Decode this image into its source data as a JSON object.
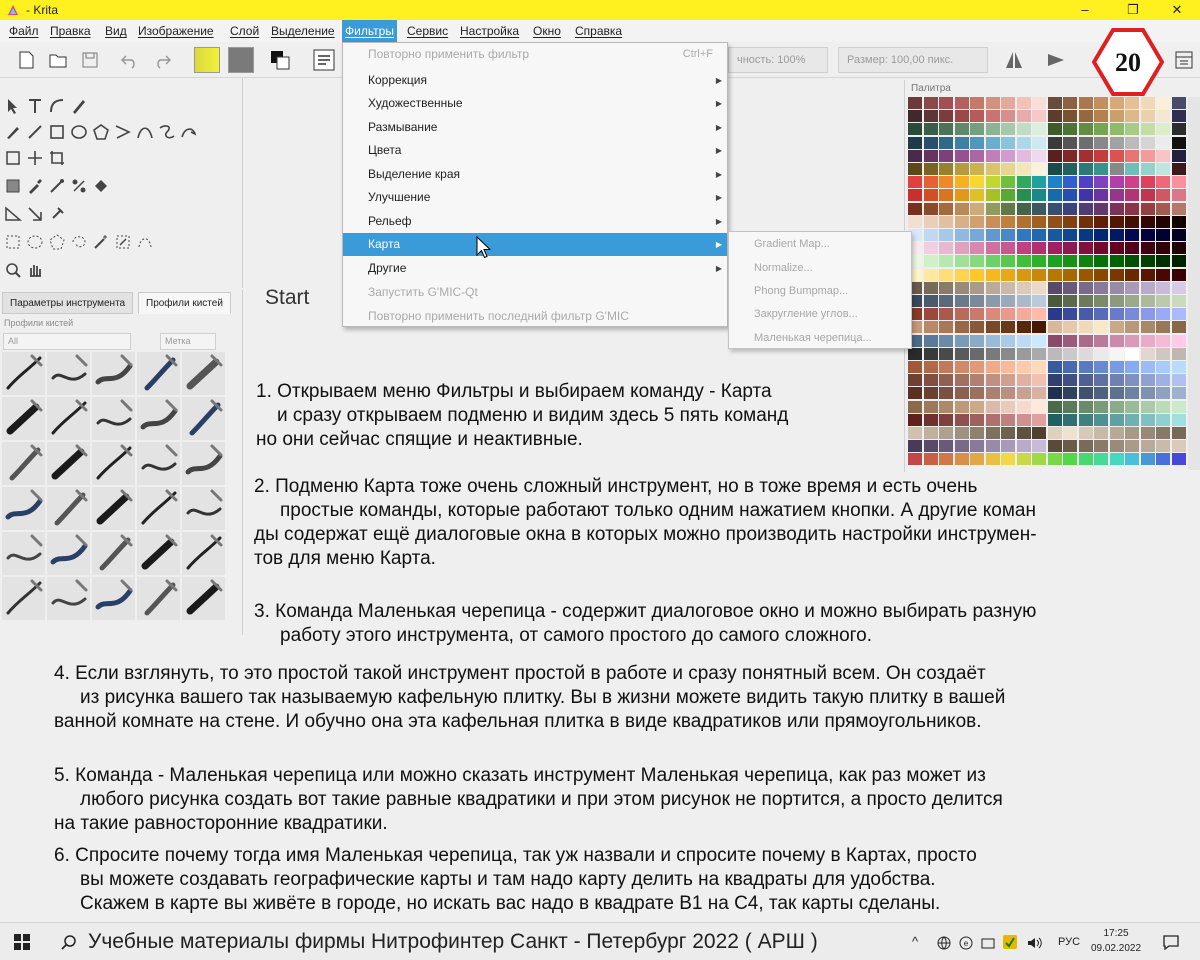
{
  "window": {
    "title": " - Krita",
    "minimize": "–",
    "maximize": "❐",
    "close": "✕"
  },
  "menu": [
    {
      "label": "Файл"
    },
    {
      "label": "Правка"
    },
    {
      "label": "Вид"
    },
    {
      "label": "Изображение"
    },
    {
      "label": "Слой"
    },
    {
      "label": "Выделение"
    },
    {
      "label": "Фильтры"
    },
    {
      "label": "Сервис"
    },
    {
      "label": "Настройка"
    },
    {
      "label": "Окно"
    },
    {
      "label": "Справка"
    }
  ],
  "toolbar": {
    "opacity_field": "чность: 100%",
    "size_field": "Размер: 100,00 пикс."
  },
  "filters_menu": {
    "items": [
      {
        "label": "Повторно применить фильтр",
        "shortcut": "Ctrl+F",
        "state": "disabled"
      },
      {
        "label": "Коррекция",
        "arrow": "▶"
      },
      {
        "label": "Художественные",
        "arrow": "▶"
      },
      {
        "label": "Размывание",
        "arrow": "▶"
      },
      {
        "label": "Цвета",
        "arrow": "▶"
      },
      {
        "label": "Выделение края",
        "arrow": "▶"
      },
      {
        "label": "Улучшение",
        "arrow": "▶"
      },
      {
        "label": "Рельеф",
        "arrow": "▶"
      },
      {
        "label": "Карта",
        "arrow": "▶",
        "state": "highlighted"
      },
      {
        "label": "Другие",
        "arrow": "▶"
      },
      {
        "label": "Запустить G'MIC-Qt",
        "state": "disabled"
      },
      {
        "label": "Повторно применить последний фильтр G'MIC",
        "state": "disabled"
      }
    ]
  },
  "map_submenu": {
    "items": [
      {
        "label": "Gradient Map..."
      },
      {
        "label": "Normalize..."
      },
      {
        "label": "Phong Bumpmap..."
      },
      {
        "label": "Закругление углов..."
      },
      {
        "label": "Маленькая черепица..."
      }
    ]
  },
  "left_dock": {
    "tab_tool_options": "Параметры инструмента",
    "tab_brush_presets": "Профили кистей",
    "title": "Профили кистей",
    "filter_value": "All",
    "tag_label": "Метка"
  },
  "canvas": {
    "start_label": "Start"
  },
  "palette": {
    "title": "Палитра"
  },
  "badge": {
    "number": "20"
  },
  "annotation": {
    "p1": [
      "1. Открываем меню Фильтры и выбираем команду - Карта",
      "и сразу открываем подменю и видим здесь 5 пять команд",
      "но они сейчас спящие и неактивные."
    ],
    "p2": [
      "2. Подменю Карта тоже очень сложный инструмент, но в тоже время и есть очень",
      "простые команды, которые работают только одним нажатием кнопки. А другие коман",
      "ды содержат ещё диалоговые окна в которых можно производить настройки инструмен-",
      "тов для меню Карта."
    ],
    "p3": [
      "3. Команда Маленькая черепица - содержит диалоговое окно и можно выбирать разную",
      "работу этого инструмента, от самого простого до самого сложного."
    ],
    "p4": [
      "4. Если взглянуть, то это простой такой инструмент простой в работе и сразу понятный всем. Он создаёт",
      "из рисунка вашего так называемую кафельную плитку. Вы в жизни можете видить такую плитку в вашей",
      "ванной комнате на стене. И обучно она эта кафельная плитка в виде квадратиков или прямоугольников."
    ],
    "p5": [
      "5. Команда - Маленькая черепица или можно сказать инструмент Маленькая черепица, как раз может из",
      "любого рисунка создать вот такие равные квадратики и при этом рисунок не портится, а просто делится",
      "на такие равносторонние квадратики."
    ],
    "p6": [
      "6. Спросите почему тогда имя Маленькая черепица, так уж назвали и спросите почему в Картах, просто",
      "вы можете создавать географические карты и там надо карту делить на квадраты для удобства.",
      "Скажем в карте вы живёте в городе, но искать вас надо в квадрате В1 на С4, так карты сделаны."
    ]
  },
  "taskbar": {
    "search_text": "Учебные материалы фирмы Нитрофинтер Санкт - Петербург  2022 ( АРШ )",
    "tray_chevron": "^",
    "lang": "РУС",
    "time": "17:25",
    "date": "09.02.2022"
  },
  "palette_colors": [
    "#6b3b3b",
    "#8a4a4a",
    "#a05050",
    "#b56060",
    "#c47a6a",
    "#d49080",
    "#e3a99a",
    "#f0c3b5",
    "#f8ded4",
    "#6a4a3a",
    "#8c6242",
    "#a9784f",
    "#c48f5f",
    "#d8a878",
    "#e6c094",
    "#f1d8b8",
    "#fbeedc",
    "#4a4a6a",
    "#3e2a2a",
    "#5e3535",
    "#7a3c3c",
    "#9a4848",
    "#b55b5b",
    "#c97373",
    "#d98e8e",
    "#e8abab",
    "#f3c9c9",
    "#5b3d2b",
    "#7a5233",
    "#95683e",
    "#b3824d",
    "#caa06a",
    "#dbb98a",
    "#e9d1ae",
    "#f5e7d2",
    "#2f2f52",
    "#2a4a3a",
    "#3a5e48",
    "#4b7358",
    "#5e8a6a",
    "#73a07e",
    "#8ab594",
    "#a4c9ab",
    "#c0dcc5",
    "#dcedde",
    "#3d5b2b",
    "#4f7335",
    "#628c40",
    "#77a550",
    "#8fba68",
    "#a8cc86",
    "#c2dda6",
    "#dcedc8",
    "#2d2d2d",
    "#1f3a4a",
    "#28506a",
    "#316888",
    "#3d80a3",
    "#5196bb",
    "#6badcc",
    "#8ac3da",
    "#abd7e6",
    "#cfe9f1",
    "#3a3a3a",
    "#555555",
    "#6e6e6e",
    "#888888",
    "#a2a2a2",
    "#bbbbbb",
    "#d4d4d4",
    "#ececec",
    "#111111",
    "#4a2a4a",
    "#63355f",
    "#7c4178",
    "#955190",
    "#ab66a6",
    "#c07fbb",
    "#d29bce",
    "#e2b9df",
    "#f0d8ee",
    "#5a2020",
    "#802828",
    "#a33030",
    "#c43c3c",
    "#dc5252",
    "#e87474",
    "#f19b9b",
    "#f8c4c4",
    "#202040",
    "#5a4a1a",
    "#7a6422",
    "#99802b",
    "#b69b38",
    "#cdb24c",
    "#dcc46a",
    "#e8d68e",
    "#f2e6b6",
    "#f9f2dc",
    "#1a4a4a",
    "#22615f",
    "#2b7a76",
    "#38938d",
    "#4dabа3",
    "#6cc0b8",
    "#93d3cc",
    "#bee5e0",
    "#3a1a1a",
    "#e04040",
    "#e86030",
    "#f08828",
    "#f8b020",
    "#f8d830",
    "#c0d830",
    "#70c040",
    "#30a860",
    "#20a0a0",
    "#2080c8",
    "#3060d0",
    "#5040c8",
    "#8040c0",
    "#b040a8",
    "#d04088",
    "#e04060",
    "#f06878",
    "#f890a0",
    "#c83030",
    "#d04f25",
    "#d87520",
    "#e09a18",
    "#e0c028",
    "#a8c028",
    "#5aa835",
    "#259050",
    "#188888",
    "#186aa8",
    "#2550b0",
    "#4035a8",
    "#6a35a0",
    "#95358c",
    "#b03570",
    "#c0354f",
    "#d05864",
    "#d87888",
    "#7a2f1f",
    "#8d4a2a",
    "#a36a3b",
    "#b88a55",
    "#cbab78",
    "#8f9c5c",
    "#627a4a",
    "#45634d",
    "#3a5a60",
    "#35506f",
    "#3b4478",
    "#4d3d72",
    "#63386b",
    "#7a3459",
    "#8a3446",
    "#944040",
    "#a35c52",
    "#b37a6b",
    "#f0e0d0",
    "#e8d0b8",
    "#e0c0a0",
    "#d8b088",
    "#d0a070",
    "#c89058",
    "#c08040",
    "#b07030",
    "#a06020",
    "#905018",
    "#804010",
    "#703008",
    "#602008",
    "#501800",
    "#401000",
    "#300800",
    "#200400",
    "#100000",
    "#d8e8f8",
    "#c0d8f0",
    "#a8c8e8",
    "#90b8e0",
    "#78a8d8",
    "#6098d0",
    "#4888c8",
    "#3078c0",
    "#2068b0",
    "#1858a0",
    "#104890",
    "#083880",
    "#042870",
    "#021860",
    "#010850",
    "#000040",
    "#000030",
    "#000020",
    "#f8e8f0",
    "#f0d0e0",
    "#e8b8d0",
    "#e0a0c0",
    "#d888b0",
    "#d070a0",
    "#c85890",
    "#c04080",
    "#b03070",
    "#a02060",
    "#901850",
    "#801040",
    "#700830",
    "#600020",
    "#500018",
    "#400010",
    "#300008",
    "#200004",
    "#e8f8e0",
    "#d0f0c8",
    "#b8e8b0",
    "#a0e098",
    "#88d880",
    "#70d068",
    "#58c850",
    "#40c038",
    "#30b028",
    "#20a020",
    "#189018",
    "#108010",
    "#087008",
    "#046004",
    "#025002",
    "#014001",
    "#003000",
    "#002000",
    "#fff4c8",
    "#ffe9a0",
    "#ffde78",
    "#ffd350",
    "#ffc828",
    "#f5b820",
    "#e8a818",
    "#d89810",
    "#c88808",
    "#b87800",
    "#a86800",
    "#985800",
    "#884800",
    "#783800",
    "#682800",
    "#581800",
    "#480800",
    "#380000",
    "#6a5a4a",
    "#7a6a5a",
    "#8a7a6a",
    "#9a8a7a",
    "#aa9a8a",
    "#baaa9a",
    "#cabaaa",
    "#dacaba",
    "#eadaca",
    "#5a4a6a",
    "#6a5a7a",
    "#7a6a8a",
    "#8a7a9a",
    "#9a8aaa",
    "#aa9aba",
    "#baaaca",
    "#cabada",
    "#dacaea",
    "#3a4a5a",
    "#4a5a6a",
    "#5a6a7a",
    "#6a7a8a",
    "#7a8a9a",
    "#8a9aaa",
    "#9aaaba",
    "#aabaca",
    "#bacada",
    "#4a5a3a",
    "#5a6a4a",
    "#6a7a5a",
    "#7a8a6a",
    "#8a9a7a",
    "#9aaa8a",
    "#aaba9a",
    "#bacaaa",
    "#cadaba",
    "#8a3a2a",
    "#9a4a3a",
    "#aa5a4a",
    "#ba6a5a",
    "#ca7a6a",
    "#da8a7a",
    "#ea9a8a",
    "#f5aa9a",
    "#ffbaaa",
    "#2a3a8a",
    "#3a4a9a",
    "#4a5aaa",
    "#5a6aba",
    "#6a7aca",
    "#7a8ada",
    "#8a9aea",
    "#9aaaf5",
    "#aabaff",
    "#c89878",
    "#b88868",
    "#a87858",
    "#986848",
    "#885838",
    "#784828",
    "#683818",
    "#582808",
    "#481800",
    "#d8b898",
    "#e8c8a8",
    "#f0d8b8",
    "#f8e8c8",
    "#c8a888",
    "#b89878",
    "#a88868",
    "#987858",
    "#886848",
    "#4a6a8a",
    "#5a7a9a",
    "#6a8aaa",
    "#7a9aba",
    "#8aaaca",
    "#9abada",
    "#aacaea",
    "#badaf5",
    "#cae8ff",
    "#8a4a6a",
    "#9a5a7a",
    "#aa6a8a",
    "#ba7a9a",
    "#ca8aaa",
    "#da9aba",
    "#eaaaca",
    "#f5bad8",
    "#ffcae8",
    "#2a2a2a",
    "#3a3a3a",
    "#4a4a4a",
    "#5a5a5a",
    "#6a6a6a",
    "#7a7a7a",
    "#8a8a8a",
    "#9a9a9a",
    "#aaaaaa",
    "#bababa",
    "#cacaca",
    "#dadada",
    "#eaeaea",
    "#f5f5f5",
    "#ffffff",
    "#e0d8d0",
    "#d0c8c0",
    "#c0b8b0",
    "#a05a3a",
    "#b06a4a",
    "#c07a5a",
    "#d08a6a",
    "#e09a7a",
    "#f0aa8a",
    "#f8ba9a",
    "#ffcaaa",
    "#ffdaba",
    "#3a5aa0",
    "#4a6ab0",
    "#5a7ac0",
    "#6a8ad0",
    "#7a9ae0",
    "#8aaaf0",
    "#9abaf8",
    "#aacaff",
    "#badaff",
    "#704030",
    "#805040",
    "#906050",
    "#a07060",
    "#b08070",
    "#c09080",
    "#d0a090",
    "#e0b0a0",
    "#f0c0b0",
    "#304070",
    "#405080",
    "#506090",
    "#6070a0",
    "#7080b0",
    "#8090c0",
    "#90a0d0",
    "#a0b0e0",
    "#b0c0f0",
    "#5a3020",
    "#6a4030",
    "#7a5040",
    "#8a6050",
    "#9a7060",
    "#aa8070",
    "#ba9080",
    "#caa090",
    "#dab0a0",
    "#203050",
    "#304060",
    "#405070",
    "#506080",
    "#607090",
    "#7080a0",
    "#8090b0",
    "#90a0c0",
    "#a0b0d0",
    "#8a6a4a",
    "#9a7a5a",
    "#aa8a6a",
    "#ba9a7a",
    "#caaa8a",
    "#dabaa9",
    "#eacab9",
    "#f5dac9",
    "#ffead9",
    "#4a6a4a",
    "#5a7a5a",
    "#6a8a6a",
    "#7a9a7a",
    "#8aaa8a",
    "#9aba9a",
    "#aacaaa",
    "#badaba",
    "#caeaca",
    "#602020",
    "#703030",
    "#804040",
    "#905050",
    "#a06060",
    "#b07070",
    "#c08080",
    "#d09090",
    "#e0a0a0",
    "#206060",
    "#307070",
    "#408080",
    "#509090",
    "#60a0a0",
    "#70b0b0",
    "#80c0c0",
    "#90d0d0",
    "#a0e0e0",
    "#d0c0b0",
    "#c0b0a0",
    "#b0a090",
    "#a09080",
    "#908070",
    "#807060",
    "#706050",
    "#605040",
    "#504030",
    "#e0d0c0",
    "#f0e0d0",
    "#d8c8b8",
    "#c8b8a8",
    "#b8a898",
    "#a89888",
    "#988878",
    "#887868",
    "#786858",
    "#4a3a5a",
    "#5a4a6a",
    "#6a5a7a",
    "#7a6a8a",
    "#8a7a9a",
    "#9a8aaa",
    "#aa9aba",
    "#baaaca",
    "#cabada",
    "#5a4a3a",
    "#6a5a4a",
    "#7a6a5a",
    "#8a7a6a",
    "#9a8a7a",
    "#aa9a8a",
    "#baaa9a",
    "#cabaaa",
    "#dacaba",
    "#c04848",
    "#c86048",
    "#d07848",
    "#d89048",
    "#e0a848",
    "#e8c048",
    "#f0d848",
    "#c8d848",
    "#a0d848",
    "#78d848",
    "#50d848",
    "#48d870",
    "#48d898",
    "#48d8c0",
    "#48c0d8",
    "#4898d8",
    "#4870d8",
    "#4848d8"
  ]
}
